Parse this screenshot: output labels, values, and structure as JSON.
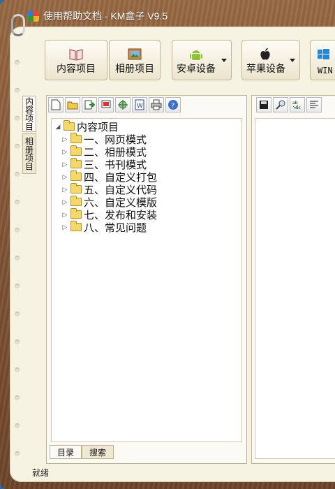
{
  "window": {
    "title": "使用帮助文档 - KM盒子 V9.5"
  },
  "top_buttons": [
    {
      "label": "内容项目",
      "icon": "open-book-icon"
    },
    {
      "label": "相册项目",
      "icon": "picture-frame-icon"
    },
    {
      "label": "安卓设备",
      "icon": "android-icon",
      "has_dropdown": true
    },
    {
      "label": "苹果设备",
      "icon": "apple-icon",
      "has_dropdown": true
    },
    {
      "label": "WIN",
      "icon": "windows-icon"
    }
  ],
  "side_tabs": [
    "内容项目",
    "相册项目"
  ],
  "left_toolbar": [
    "new-document-icon",
    "open-folder-icon",
    "import-icon",
    "export-icon",
    "target-icon",
    "word-icon",
    "print-icon",
    "help-icon"
  ],
  "right_toolbar": [
    "save-icon",
    "find-icon",
    "spellcheck-icon",
    "align-left-icon"
  ],
  "tree": {
    "root": "内容项目",
    "children": [
      "一、网页模式",
      "二、相册模式",
      "三、书刊模式",
      "四、自定义打包",
      "五、自定义代码",
      "六、自定义模版",
      "七、发布和安装",
      "八、常见问题"
    ]
  },
  "bottom_tabs": [
    "目录",
    "搜索"
  ],
  "status_text": "就绪",
  "colors": {
    "paper": "#f7f3e3",
    "wood": "#8a5c39",
    "desktop": "#3f7fb0"
  }
}
